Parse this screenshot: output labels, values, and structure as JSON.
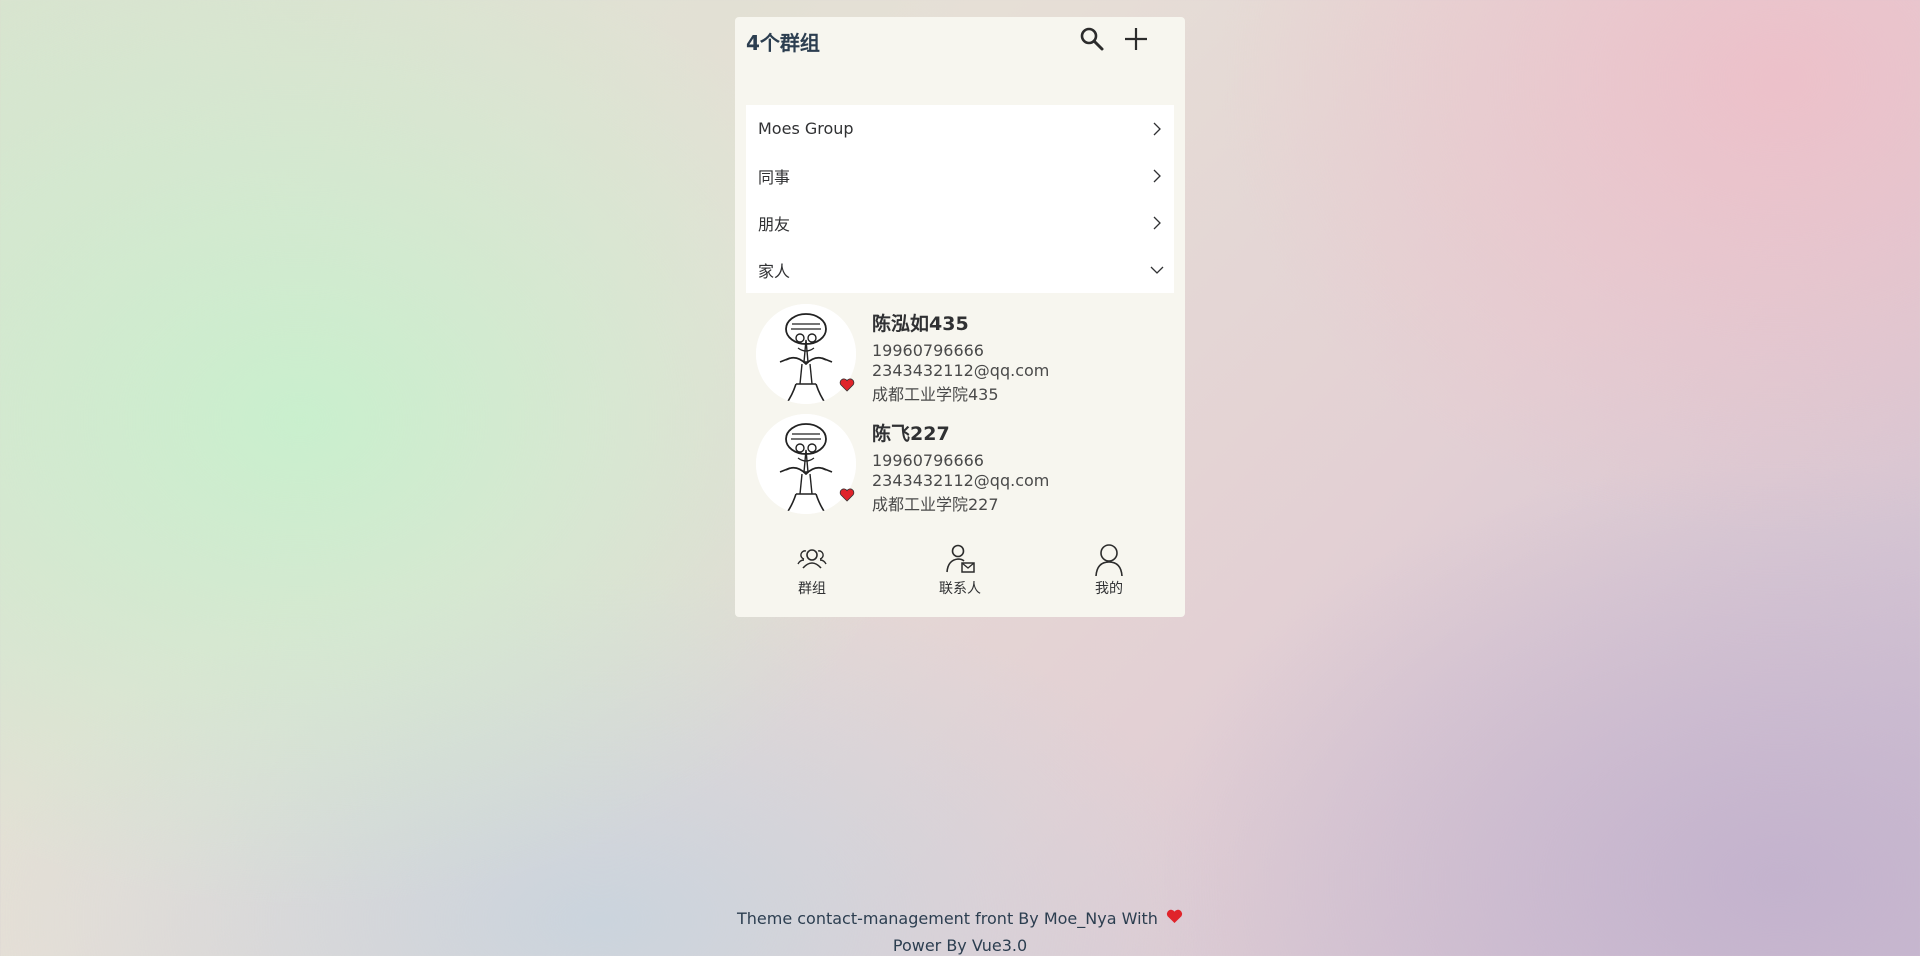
{
  "header": {
    "title": "4个群组",
    "search_icon": "search-icon",
    "add_icon": "plus-icon"
  },
  "groups": [
    {
      "label": "Moes Group",
      "expanded": false
    },
    {
      "label": "同事",
      "expanded": false
    },
    {
      "label": "朋友",
      "expanded": false
    },
    {
      "label": "家人",
      "expanded": true
    }
  ],
  "contacts": [
    {
      "name": "陈泓如435",
      "phone": "19960796666",
      "email": "2343432112@qq.com",
      "school": "成都工业学院435",
      "favorite": true
    },
    {
      "name": "陈飞227",
      "phone": "19960796666",
      "email": "2343432112@qq.com",
      "school": "成都工业学院227",
      "favorite": true
    }
  ],
  "tabbar": {
    "groups_label": "群组",
    "contacts_label": "联系人",
    "mine_label": "我的"
  },
  "footer": {
    "line1": "Theme contact-management front By Moe_Nya With",
    "line2": "Power By Vue3.0"
  },
  "colors": {
    "accent_heart": "#e0242b",
    "panel_bg": "#f7f6ef"
  }
}
